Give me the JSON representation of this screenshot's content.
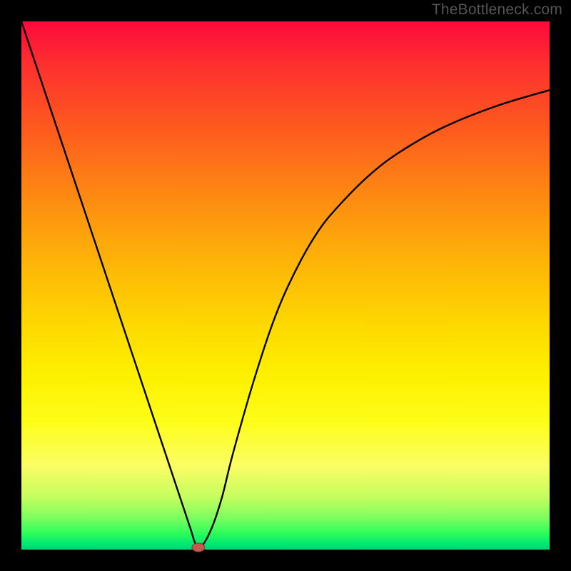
{
  "watermark": "TheBottleneck.com",
  "colors": {
    "frame": "#000000",
    "curve_stroke": "#000000",
    "marker_fill": "#c45a4f",
    "marker_stroke": "#8a3a33"
  },
  "chart_data": {
    "type": "line",
    "title": "",
    "xlabel": "",
    "ylabel": "",
    "xlim": [
      0,
      100
    ],
    "ylim": [
      0,
      100
    ],
    "grid": false,
    "series": [
      {
        "name": "bottleneck-curve",
        "x": [
          0,
          4,
          8,
          12,
          16,
          20,
          24,
          28,
          30,
          32,
          33,
          34,
          36,
          38,
          40,
          44,
          48,
          52,
          56,
          60,
          66,
          72,
          80,
          90,
          100
        ],
        "y": [
          100,
          88,
          76,
          64,
          52,
          40,
          28,
          16,
          10,
          4,
          1,
          0.5,
          4,
          10,
          18,
          32,
          44,
          53,
          60,
          65,
          71,
          75.5,
          80,
          84,
          87
        ]
      }
    ],
    "annotations": [
      {
        "name": "min-marker",
        "x": 33.5,
        "y": 0,
        "shape": "oval"
      }
    ]
  }
}
